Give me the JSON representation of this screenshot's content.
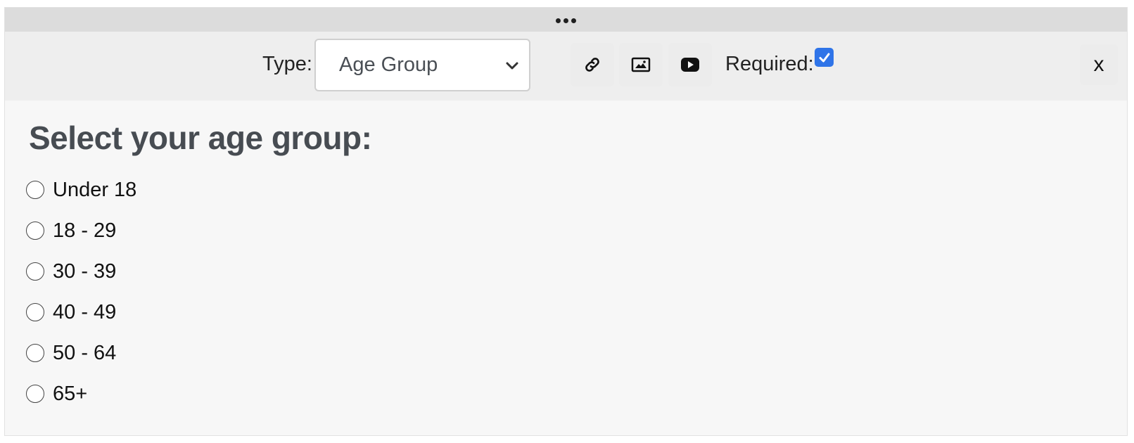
{
  "toolbar": {
    "type_label": "Type:",
    "type_value": "Age Group",
    "required_label": "Required:",
    "required_checked": true,
    "close_label": "x",
    "icons": [
      "link-icon",
      "image-icon",
      "youtube-icon"
    ]
  },
  "question": {
    "title": "Select your age group:",
    "options": [
      "Under 18",
      "18 - 29",
      "30 - 39",
      "40 - 49",
      "50 - 64",
      "65+"
    ]
  },
  "colors": {
    "accent": "#2f74e8",
    "heading": "#474c52"
  }
}
